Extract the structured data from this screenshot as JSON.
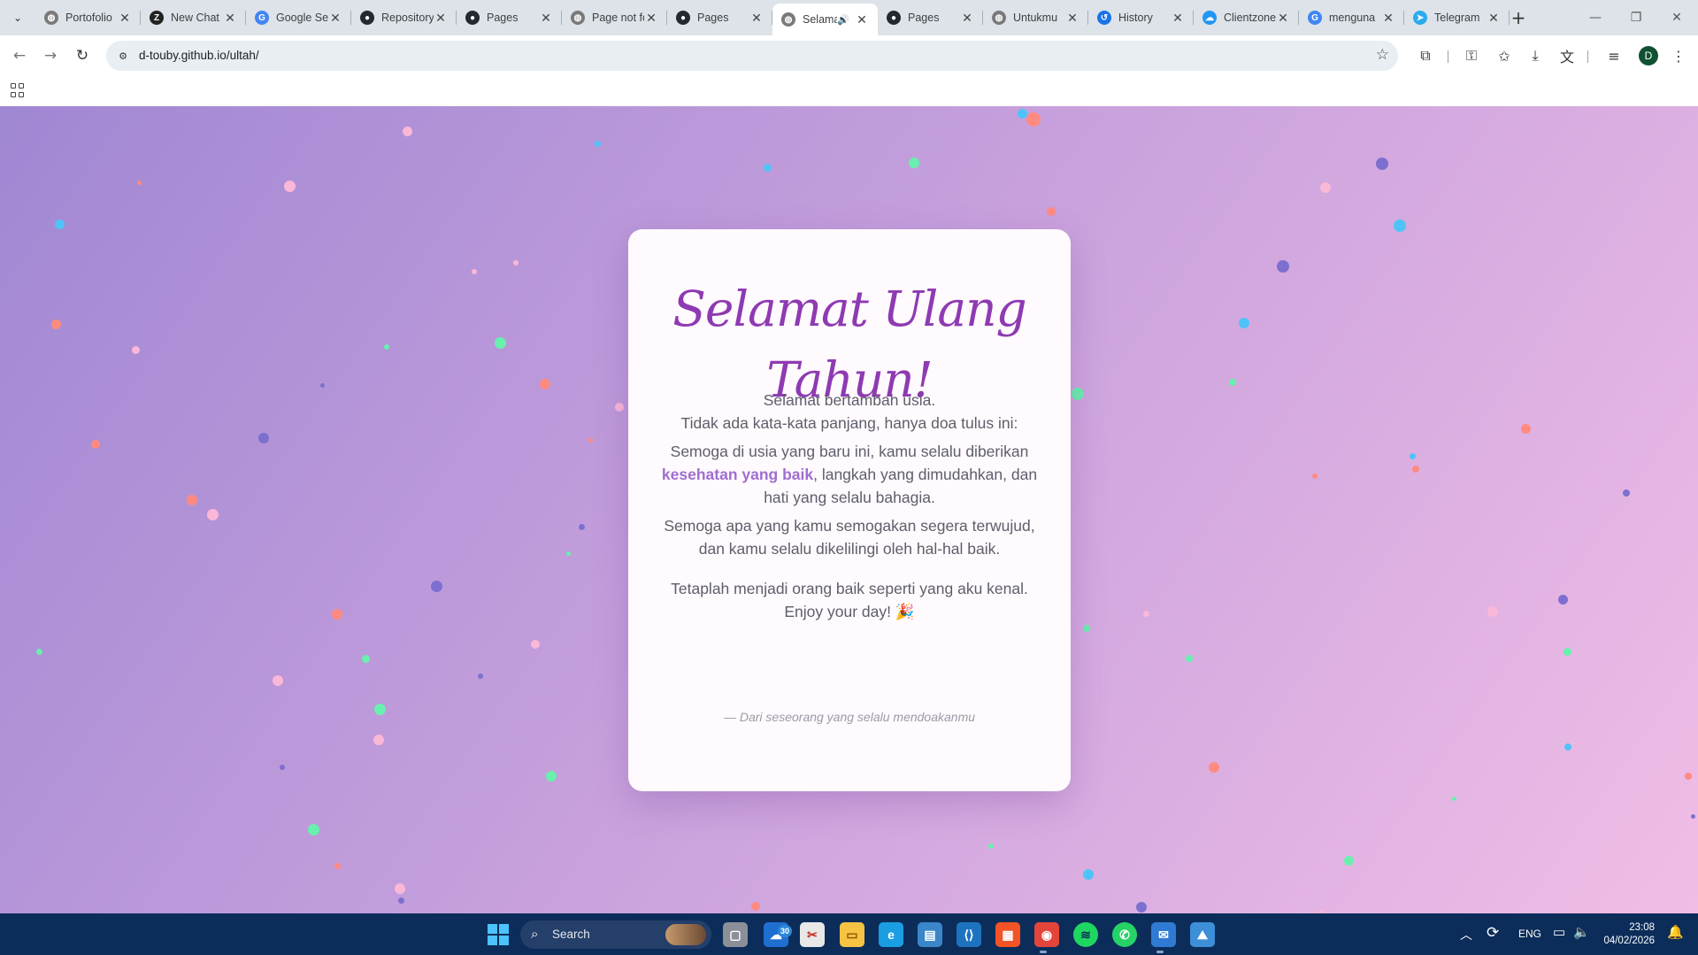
{
  "colors": {
    "page_gradient_start": "#a087d3",
    "page_gradient_end": "#f0bde6",
    "title": "#8e3ab2",
    "highlight": "#a06ed0",
    "taskbar": "#0c2d5a"
  },
  "browser": {
    "tabs": [
      {
        "title": "Portofolio",
        "icon": "globe-icon",
        "color": "#7a7a7a",
        "active": false
      },
      {
        "title": "New Chat",
        "icon": "z-logo-icon",
        "color": "#222222",
        "active": false
      },
      {
        "title": "Google Search",
        "icon": "google-icon",
        "color": "#4285f4",
        "active": false
      },
      {
        "title": "Repository",
        "icon": "github-icon",
        "color": "#24292f",
        "active": false
      },
      {
        "title": "Pages",
        "icon": "github-icon",
        "color": "#24292f",
        "active": false
      },
      {
        "title": "Page not found",
        "icon": "globe-icon",
        "color": "#7a7a7a",
        "active": false
      },
      {
        "title": "Pages",
        "icon": "github-icon",
        "color": "#24292f",
        "active": false
      },
      {
        "title": "Selamat",
        "icon": "globe-icon",
        "color": "#7a7a7a",
        "active": true,
        "audio": true
      },
      {
        "title": "Pages",
        "icon": "github-icon",
        "color": "#24292f",
        "active": false
      },
      {
        "title": "Untukmu",
        "icon": "globe-icon",
        "color": "#7a7a7a",
        "active": false
      },
      {
        "title": "History",
        "icon": "history-icon",
        "color": "#1a73e8",
        "active": false
      },
      {
        "title": "Clientzone",
        "icon": "cloud-icon",
        "color": "#2196f3",
        "active": false
      },
      {
        "title": "menguna",
        "icon": "google-icon",
        "color": "#4285f4",
        "active": false
      },
      {
        "title": "Telegram",
        "icon": "telegram-icon",
        "color": "#2aabee",
        "active": false
      }
    ],
    "address": "d-touby.github.io/ultah/"
  },
  "card": {
    "title_line1": "Selamat Ulang",
    "title_line2": "Tahun!",
    "p1_line1": "Selamat bertambah usia.",
    "p1_line2": "Tidak ada kata-kata panjang, hanya doa tulus ini:",
    "p2_line1": "Semoga di usia yang baru ini, kamu selalu diberikan",
    "p2_highlight": "kesehatan yang baik",
    "p2_rest": ", langkah yang dimudahkan, dan",
    "p2_line3": "hati yang selalu bahagia.",
    "p3_line1": "Semoga apa yang kamu semogakan segera terwujud,",
    "p3_line2": "dan kamu selalu dikelilingi oleh hal-hal baik.",
    "p4_line1": "Tetaplah menjadi orang baik seperti yang aku kenal.",
    "p4_line2": "Enjoy your day! 🎉",
    "signature": "— Dari seseorang yang selalu mendoakanmu"
  },
  "taskbar": {
    "search_label": "Search",
    "badge_count": "30",
    "language": "ENG",
    "time": "23:08",
    "date": "04/02/2026"
  }
}
